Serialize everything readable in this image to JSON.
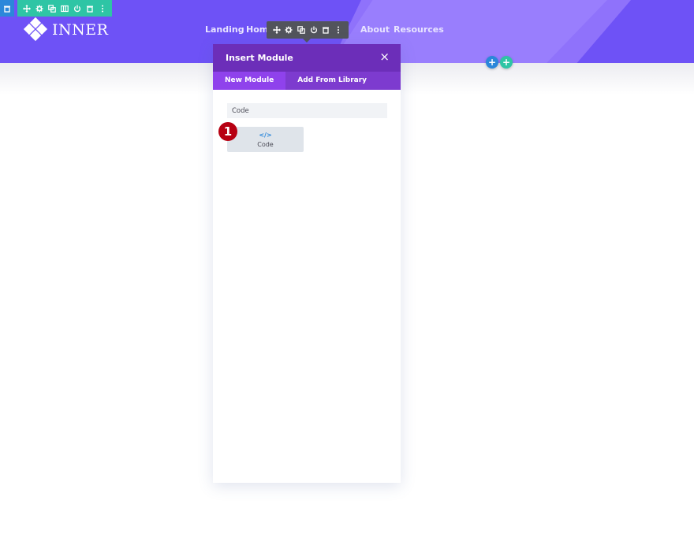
{
  "header": {
    "logo_text": "INNER",
    "nav": [
      {
        "label": "Landing"
      },
      {
        "label": "Home"
      },
      {
        "label": "About"
      },
      {
        "label": "Resources"
      }
    ],
    "colors": {
      "primary": "#6e52f6",
      "accent": "#8f72fb"
    }
  },
  "toolbars": {
    "section": {
      "color": "#2b87da",
      "tools": [
        "trash-icon"
      ]
    },
    "row": {
      "color": "#2ec5a5",
      "tools": [
        "move-icon",
        "gear-icon",
        "duplicate-icon",
        "columns-icon",
        "power-icon",
        "trash-icon",
        "more-icon"
      ]
    },
    "module": {
      "color": "#52545c",
      "tools": [
        "move-icon",
        "gear-icon",
        "duplicate-icon",
        "power-icon",
        "trash-icon",
        "more-icon"
      ]
    }
  },
  "add_buttons": {
    "add_section": "+",
    "add_row": "+"
  },
  "modal": {
    "title": "Insert Module",
    "close_symbol": "×",
    "tabs": [
      {
        "label": "New Module",
        "active": true
      },
      {
        "label": "Add From Library",
        "active": false
      }
    ],
    "search_value": "Code",
    "results": [
      {
        "icon": "</>",
        "label": "Code"
      }
    ],
    "colors": {
      "header": "#6c2eb9",
      "tabs": "#7d3bcf",
      "active_tab": "#8f42ec"
    }
  },
  "annotation": {
    "step": "1"
  }
}
